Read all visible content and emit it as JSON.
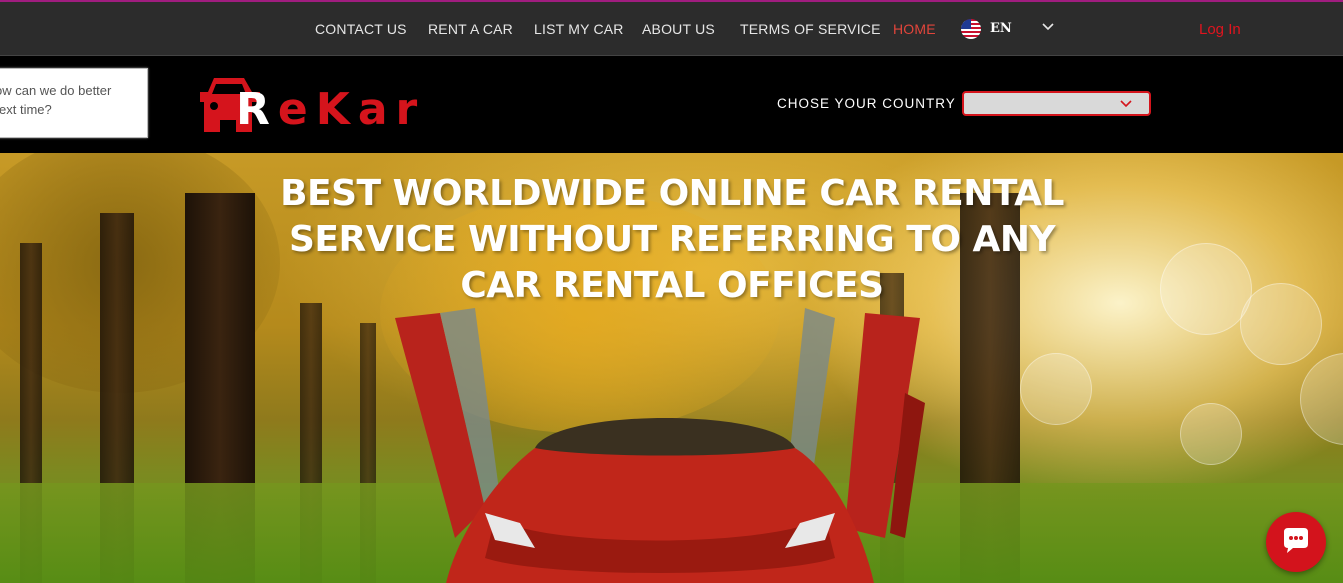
{
  "nav": {
    "items": [
      "CONTACT US",
      "RENT A CAR",
      "LIST MY CAR",
      "ABOUT US",
      "TERMS OF SERVICE",
      "HOME"
    ],
    "active": "HOME"
  },
  "language": {
    "code": "EN",
    "flag_icon": "us-flag-icon"
  },
  "login_label": "Log In",
  "feedback": {
    "text": "ow can we do better\next time?"
  },
  "logo": {
    "letters": [
      "R",
      "e",
      "K",
      "a",
      "r"
    ]
  },
  "country": {
    "label": "CHOSE YOUR COUNTRY",
    "selected": ""
  },
  "hero": {
    "headline": "BEST WORLDWIDE ONLINE CAR RENTAL SERVICE WITHOUT REFERRING TO ANY CAR RENTAL OFFICES"
  },
  "colors": {
    "brand_red": "#d5141c",
    "accent_top": "#a01d7f",
    "nav_bg": "#2c2c2c"
  },
  "chat": {
    "icon": "chat-bubble-icon"
  }
}
